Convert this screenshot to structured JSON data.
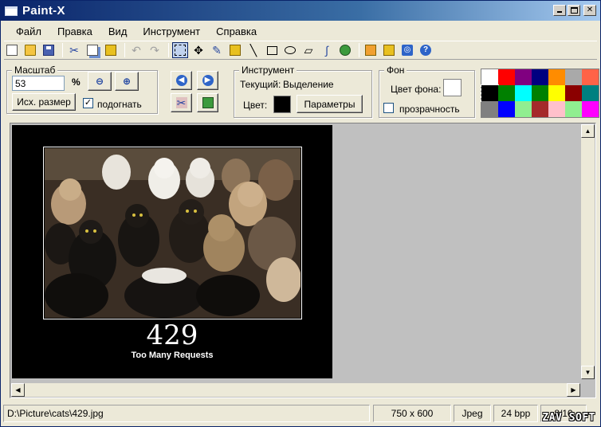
{
  "window": {
    "title": "Paint-X"
  },
  "menu": [
    "Файл",
    "Правка",
    "Вид",
    "Инструмент",
    "Справка"
  ],
  "toolbar": {
    "buttons": [
      {
        "icon": "new-document-icon"
      },
      {
        "icon": "open-folder-icon"
      },
      {
        "icon": "save-disk-icon"
      },
      {
        "icon": "cut-icon"
      },
      {
        "icon": "copy-icon"
      },
      {
        "icon": "paste-icon"
      },
      {
        "icon": "undo-icon"
      },
      {
        "icon": "redo-icon"
      },
      {
        "icon": "selection-icon"
      },
      {
        "icon": "move-icon"
      },
      {
        "icon": "pencil-icon"
      },
      {
        "icon": "stamp-icon"
      },
      {
        "icon": "line-icon"
      },
      {
        "icon": "rectangle-icon"
      },
      {
        "icon": "ellipse-icon"
      },
      {
        "icon": "polygon-icon"
      },
      {
        "icon": "curve-icon"
      },
      {
        "icon": "fill-icon"
      },
      {
        "icon": "effects-icon"
      },
      {
        "icon": "image-icon"
      },
      {
        "icon": "web-icon"
      },
      {
        "icon": "help-icon"
      }
    ]
  },
  "scale": {
    "group_title": "Масштаб",
    "value": "53",
    "unit": "%",
    "original_size_label": "Исх. размер",
    "fit_label": "подогнать",
    "fit_checked": true
  },
  "tool": {
    "group_title": "Инструмент",
    "current_label": "Текущий:",
    "current_value": "Выделение",
    "color_label": "Цвет:",
    "color": "#000000",
    "params_label": "Параметры"
  },
  "background": {
    "group_title": "Фон",
    "bg_color_label": "Цвет фона:",
    "bg_color": "#ffffff",
    "transparency_label": "прозрачность",
    "transparency_checked": false
  },
  "palette": [
    "#ffffff",
    "#ff0000",
    "#800080",
    "#000080",
    "#ff8c00",
    "#a9a9a9",
    "#ff6347",
    "#000000",
    "#008000",
    "#00ffff",
    "#008000",
    "#ffff00",
    "#8b0000",
    "#008080",
    "#808080",
    "#0000ff",
    "#90ee90",
    "#a52a2a",
    "#ffc0cb",
    "#90ee90",
    "#ff00ff"
  ],
  "image": {
    "code": "429",
    "message": "Too Many Requests"
  },
  "status": {
    "path": "D:\\Picture\\cats\\429.jpg",
    "dimensions": "750 x 600",
    "format": "Jpeg",
    "bpp": "24 bpp",
    "index": "8/10",
    "brand": "ZAV SOFT"
  }
}
